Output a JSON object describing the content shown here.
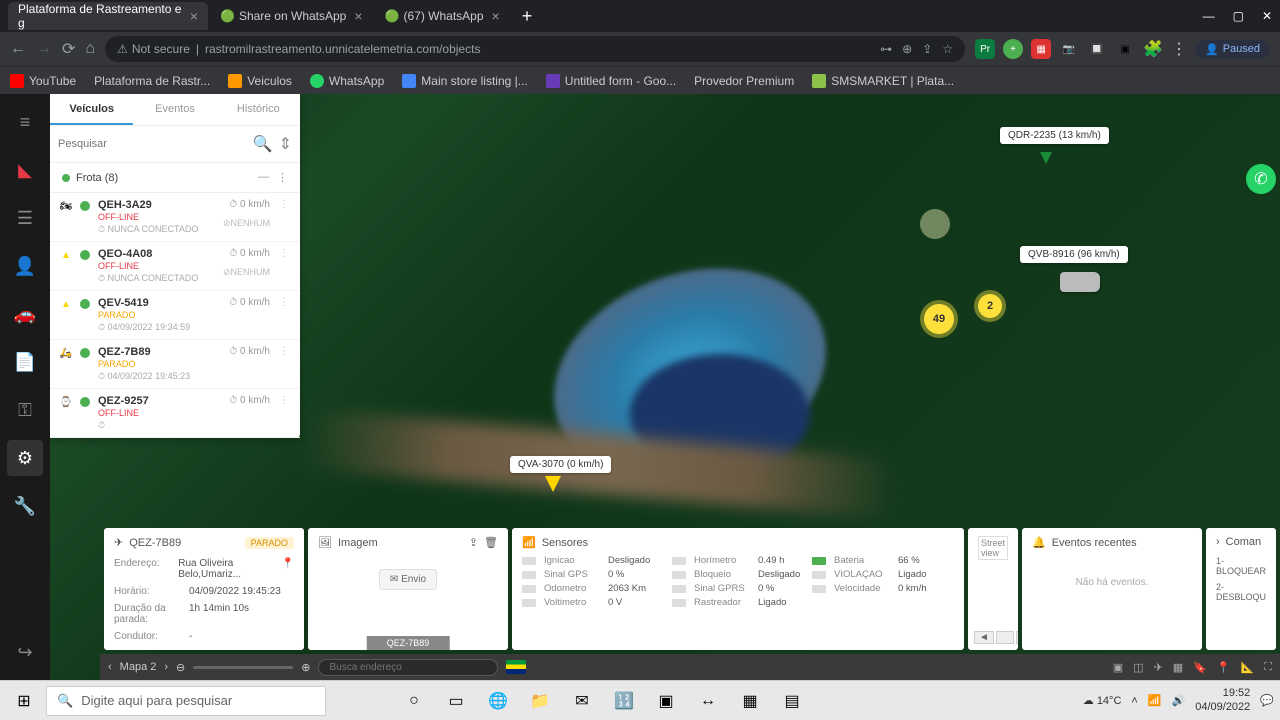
{
  "browser": {
    "tabs": [
      {
        "title": "Plataforma de Rastreamento e g",
        "active": true
      },
      {
        "title": "Share on WhatsApp",
        "active": false
      },
      {
        "title": "(67) WhatsApp",
        "active": false
      }
    ],
    "security_label": "Not secure",
    "url": "rastromilrastreamento.unnicatelemetria.com/objects",
    "paused": "Paused",
    "bookmarks": [
      "YouTube",
      "Plataforma de Rastr...",
      "Veiculos",
      "WhatsApp",
      "Main store listing |...",
      "Untitled form - Goo...",
      "Provedor Premium",
      "SMSMARKET | Plata..."
    ]
  },
  "panel": {
    "tabs": {
      "veiculos": "Veículos",
      "eventos": "Eventos",
      "historico": "Histórico"
    },
    "search_placeholder": "Pesquisar",
    "fleet_label": "Frota (8)",
    "vehicles": [
      {
        "plate": "QEH-3A29",
        "status": "OFF-LINE",
        "status_class": "offline",
        "ts": "NUNCA CONECTADO",
        "speed": "0 km/h",
        "extra": "NENHUM",
        "icon": "moto"
      },
      {
        "plate": "QEO-4A08",
        "status": "OFF-LINE",
        "status_class": "offline",
        "ts": "NUNCA CONECTADO",
        "speed": "0 km/h",
        "extra": "NENHUM",
        "icon": "tri-y"
      },
      {
        "plate": "QEV-5419",
        "status": "PARADO",
        "status_class": "parado",
        "ts": "04/09/2022 19:34:59",
        "speed": "0 km/h",
        "extra": "",
        "icon": "tri-y"
      },
      {
        "plate": "QEZ-7B89",
        "status": "PARADO",
        "status_class": "parado",
        "ts": "04/09/2022 19:45:23",
        "speed": "0 km/h",
        "extra": "",
        "icon": "moto2"
      },
      {
        "plate": "QEZ-9257",
        "status": "OFF-LINE",
        "status_class": "offline",
        "ts": "",
        "speed": "0 km/h",
        "extra": "",
        "icon": "box"
      }
    ]
  },
  "map": {
    "markers": {
      "qdr": "QDR-2235 (13 km/h)",
      "qvb": "QVB-8916 (96 km/h)",
      "qva": "QVA-3070 (0 km/h)"
    },
    "clusters": {
      "c1": "49",
      "c2": "2"
    }
  },
  "info": {
    "plate": "QEZ-7B89",
    "status": "PARADO",
    "image_label": "Imagem",
    "image_tab": "QEZ-7B89",
    "send": "Envio",
    "details_labels": {
      "endereco": "Endereço:",
      "horario": "Horário:",
      "duracao": "Duração da parada:",
      "condutor": "Condutor:"
    },
    "details": {
      "endereco": "Rua Oliveira Belo,Umariz...",
      "horario": "04/09/2022 19:45:23",
      "duracao": "1h 14min 10s",
      "condutor": "-"
    },
    "sensors_label": "Sensores",
    "sensors": {
      "ignicao_l": "Ignicao",
      "ignicao_v": "Desligado",
      "horimetro_l": "Horímetro",
      "horimetro_v": "0.49 h",
      "bateria_l": "Bateria",
      "bateria_v": "66 %",
      "sinalgps_l": "Sinal GPS",
      "sinalgps_v": "0 %",
      "bloqueio_l": "Bloqueio",
      "bloqueio_v": "Desligado",
      "violacao_l": "VIOLAÇAO",
      "violacao_v": "Ligado",
      "odometro_l": "Odometro",
      "odometro_v": "2063 Km",
      "sinalgprs_l": "Sinal GPRS",
      "sinalgprs_v": "0 %",
      "velocidade_l": "Velocidade",
      "velocidade_v": "0 km/h",
      "voltimetro_l": "Voltimetro",
      "voltimetro_v": "0 V",
      "rastreador_l": "Rastreador",
      "rastreador_v": "Ligado"
    },
    "events_label": "Eventos recentes",
    "events_empty": "Não há eventos.",
    "streetview": "Street view",
    "cmd_label": "Coman",
    "cmd1": "1-BLOQUEAR",
    "cmd2": "2-DESBLOQU"
  },
  "mapbar": {
    "map_label": "Mapa 2",
    "search_placeholder": "Busca endereço"
  },
  "taskbar": {
    "search": "Digite aqui para pesquisar",
    "weather": "14°C",
    "time": "19:52",
    "date": "04/09/2022"
  }
}
